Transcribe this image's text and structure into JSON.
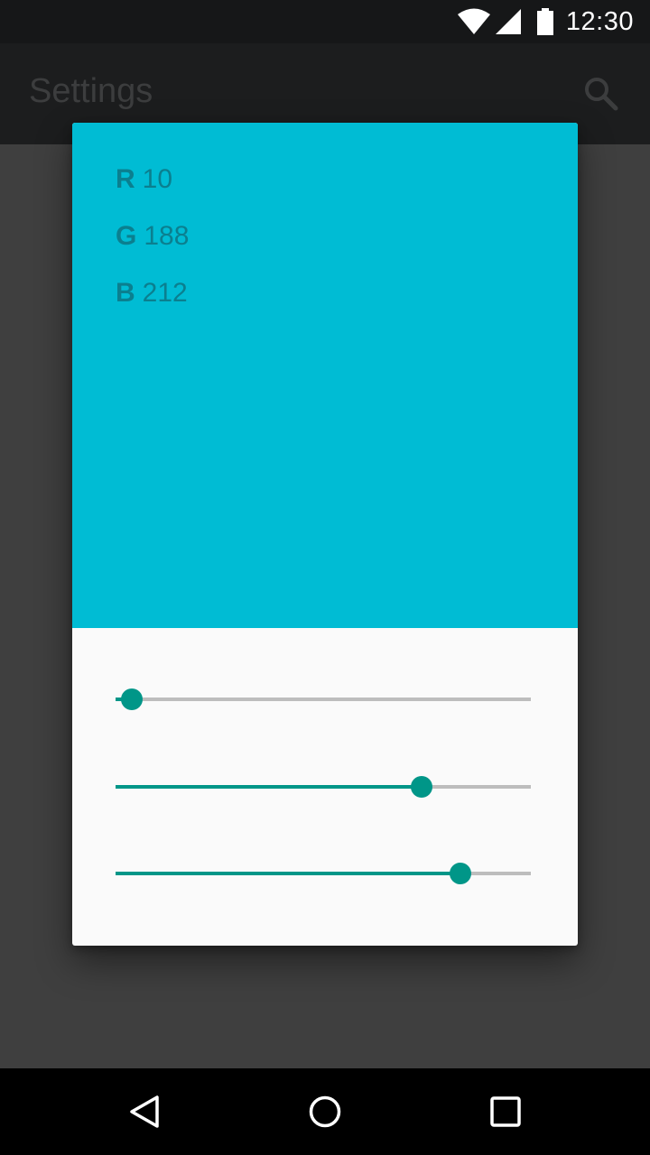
{
  "status_bar": {
    "time": "12:30",
    "icons": [
      "wifi-icon",
      "cell-signal-icon",
      "battery-icon"
    ]
  },
  "app_bar": {
    "title": "Settings",
    "search_icon": "search-icon"
  },
  "dialog": {
    "swatch_color": "#00BCD4",
    "channels": [
      {
        "letter": "R",
        "value": "10",
        "level": 10
      },
      {
        "letter": "G",
        "value": "188",
        "level": 188
      },
      {
        "letter": "B",
        "value": "212",
        "level": 212
      }
    ],
    "slider_max": 255,
    "accent_color": "#009688"
  },
  "nav_bar": {
    "buttons": [
      "back-icon",
      "home-icon",
      "recents-icon"
    ]
  }
}
